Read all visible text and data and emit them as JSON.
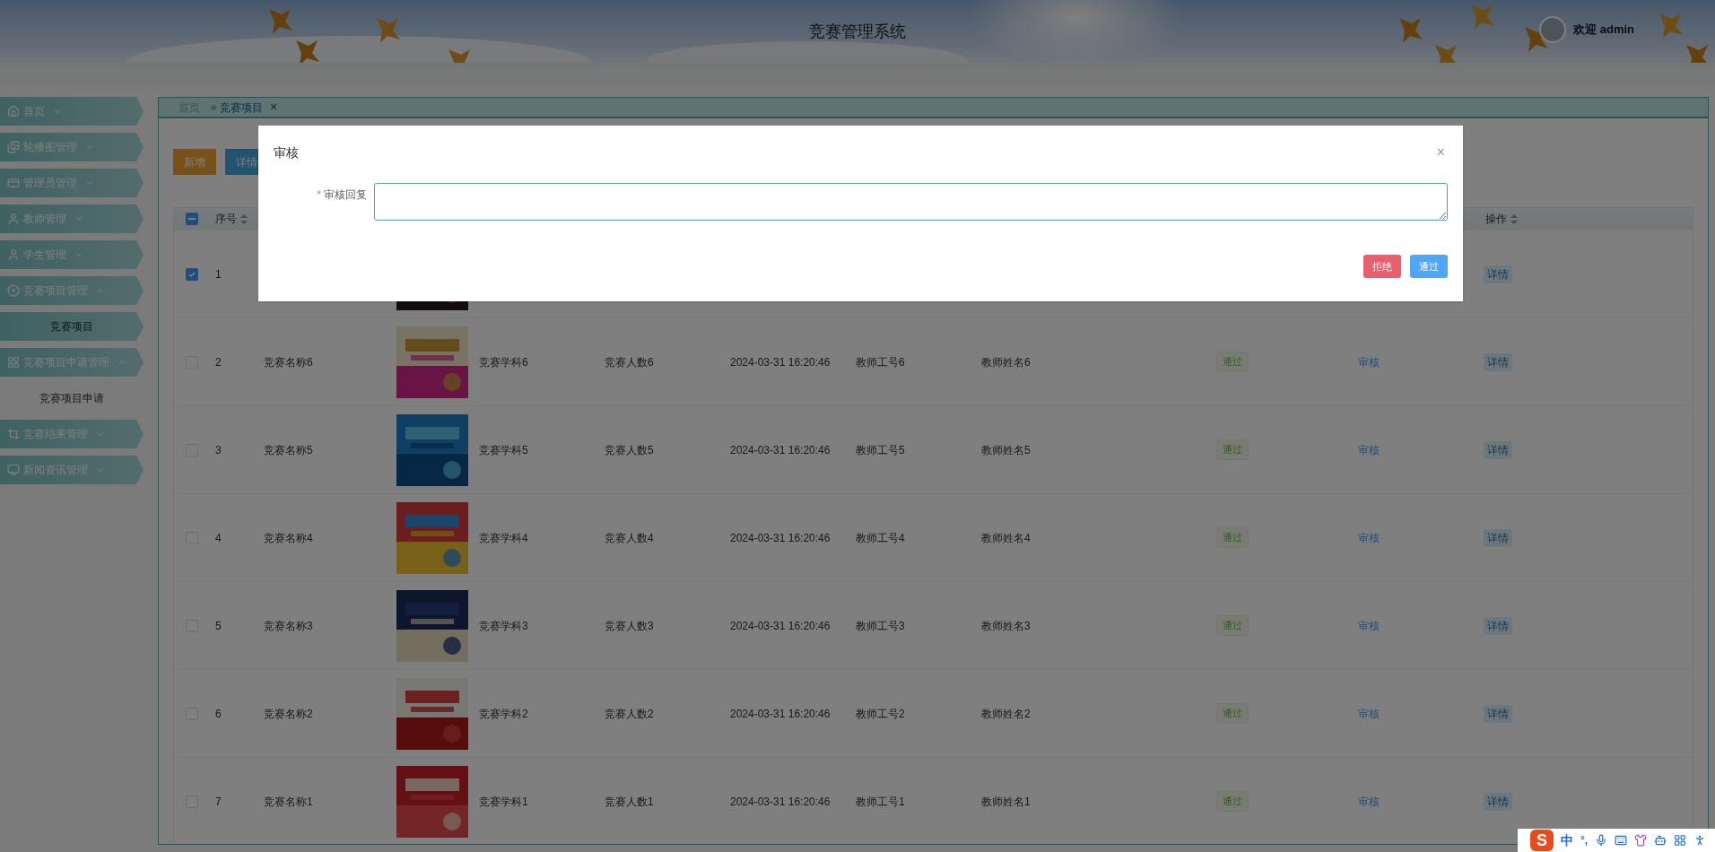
{
  "header": {
    "title": "竞赛管理系统",
    "welcome": "欢迎 admin"
  },
  "sidebar": {
    "items": [
      {
        "label": "首页",
        "expanded": false
      },
      {
        "label": "轮播图管理",
        "expanded": false
      },
      {
        "label": "管理员管理",
        "expanded": false
      },
      {
        "label": "教师管理",
        "expanded": false
      },
      {
        "label": "学生管理",
        "expanded": false
      },
      {
        "label": "竞赛项目管理",
        "expanded": true,
        "children": [
          {
            "label": "竞赛项目",
            "selected": true
          }
        ]
      },
      {
        "label": "竞赛项目申请管理",
        "expanded": true,
        "children": [
          {
            "label": "竞赛项目申请",
            "selected": false
          }
        ]
      },
      {
        "label": "竞赛结果管理",
        "expanded": false
      },
      {
        "label": "新闻资讯管理",
        "expanded": false
      }
    ]
  },
  "tabs": [
    {
      "label": "首页",
      "selected": false
    },
    {
      "label": "竞赛项目",
      "selected": true,
      "close": "×"
    }
  ],
  "toolbar": [
    {
      "label": "新增",
      "kind": "add"
    },
    {
      "label": "详情",
      "kind": "detail"
    }
  ],
  "table": {
    "header_checkbox": {
      "indeterminate": true
    },
    "columns": {
      "index": "序号",
      "action": "操作"
    },
    "rows": [
      {
        "checked": true,
        "index": "1",
        "action": "详情"
      },
      {
        "checked": false,
        "index": "2",
        "name": "竞赛名称6",
        "subject": "竞赛学科6",
        "count": "竞赛人数6",
        "time": "2024-03-31 16:20:46",
        "teacher_id": "教师工号6",
        "teacher_name": "教师姓名6",
        "status": "通过",
        "review": "审核",
        "action": "详情"
      },
      {
        "checked": false,
        "index": "3",
        "name": "竞赛名称5",
        "subject": "竞赛学科5",
        "count": "竞赛人数5",
        "time": "2024-03-31 16:20:46",
        "teacher_id": "教师工号5",
        "teacher_name": "教师姓名5",
        "status": "通过",
        "review": "审核",
        "action": "详情"
      },
      {
        "checked": false,
        "index": "4",
        "name": "竞赛名称4",
        "subject": "竞赛学科4",
        "count": "竞赛人数4",
        "time": "2024-03-31 16:20:46",
        "teacher_id": "教师工号4",
        "teacher_name": "教师姓名4",
        "status": "通过",
        "review": "审核",
        "action": "详情"
      },
      {
        "checked": false,
        "index": "5",
        "name": "竞赛名称3",
        "subject": "竞赛学科3",
        "count": "竞赛人数3",
        "time": "2024-03-31 16:20:46",
        "teacher_id": "教师工号3",
        "teacher_name": "教师姓名3",
        "status": "通过",
        "review": "审核",
        "action": "详情"
      },
      {
        "checked": false,
        "index": "6",
        "name": "竞赛名称2",
        "subject": "竞赛学科2",
        "count": "竞赛人数2",
        "time": "2024-03-31 16:20:46",
        "teacher_id": "教师工号2",
        "teacher_name": "教师姓名2",
        "status": "通过",
        "review": "审核",
        "action": "详情"
      },
      {
        "checked": false,
        "index": "7",
        "name": "竞赛名称1",
        "subject": "竞赛学科1",
        "count": "竞赛人数1",
        "time": "2024-03-31 16:20:46",
        "teacher_id": "教师工号1",
        "teacher_name": "教师姓名1",
        "status": "通过",
        "review": "审核",
        "action": "详情"
      }
    ]
  },
  "dialog": {
    "title": "审核",
    "close": "×",
    "field": {
      "label": "审核回复",
      "required": true,
      "required_mark": "*"
    },
    "buttons": [
      {
        "label": "拒绝",
        "kind": "danger"
      },
      {
        "label": "通过",
        "kind": "primary"
      }
    ]
  },
  "ime": {
    "logo": "S",
    "mode": "中",
    "punct": "°,"
  }
}
